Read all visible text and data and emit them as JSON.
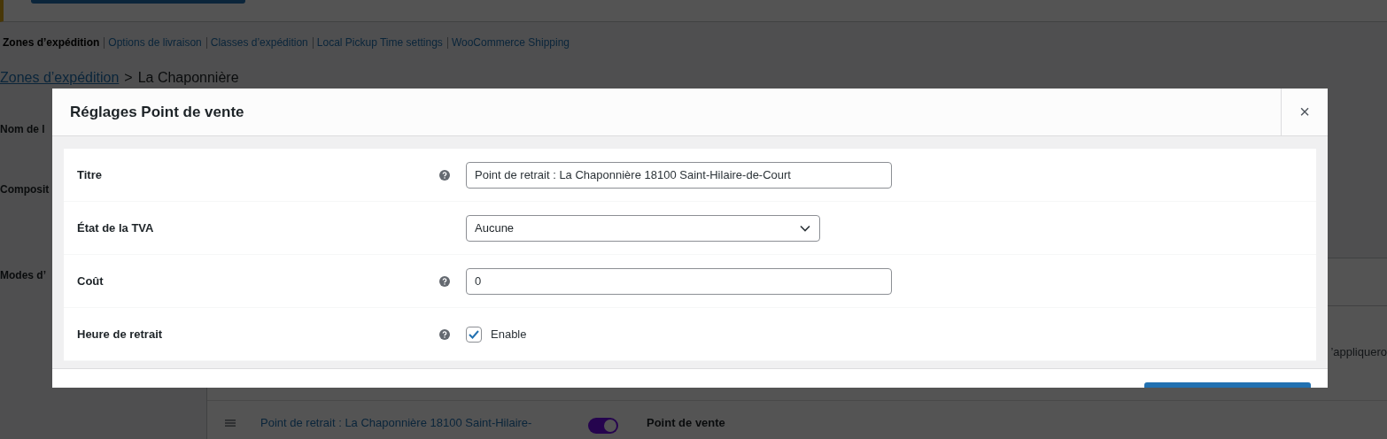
{
  "nav_links": [
    {
      "label": "Zones d’expédition",
      "selected": true
    },
    {
      "label": "Options de livraison",
      "selected": false
    },
    {
      "label": "Classes d’expédition",
      "selected": false
    },
    {
      "label": "Local Pickup Time settings",
      "selected": false
    },
    {
      "label": "WooCommerce Shipping",
      "selected": false
    }
  ],
  "breadcrumb": {
    "link": "Zones d’expédition",
    "separator": ">",
    "current": "La Chaponnière"
  },
  "settings_labels": [
    "Nom de l",
    "Composit",
    "Modes d’"
  ],
  "methods_table": {
    "partial_text": "’appliquero",
    "rows": [
      {
        "title": "Point de retrait : La Chaponnière 18100 Saint-Hilaire-",
        "enabled": true,
        "method": "Point de vente"
      }
    ]
  },
  "modal": {
    "title": "Réglages Point de vente",
    "close": "×",
    "fields": [
      {
        "kind": "text",
        "label": "Titre",
        "help": true,
        "value": "Point de retrait : La Chaponnière 18100 Saint-Hilaire-de-Court"
      },
      {
        "kind": "select",
        "label": "État de la TVA",
        "help": false,
        "value": "Aucune"
      },
      {
        "kind": "text",
        "label": "Coût",
        "help": true,
        "value": "0"
      },
      {
        "kind": "checkbox",
        "label": "Heure de retrait",
        "help": true,
        "checked": true,
        "text": "Enable"
      }
    ]
  }
}
